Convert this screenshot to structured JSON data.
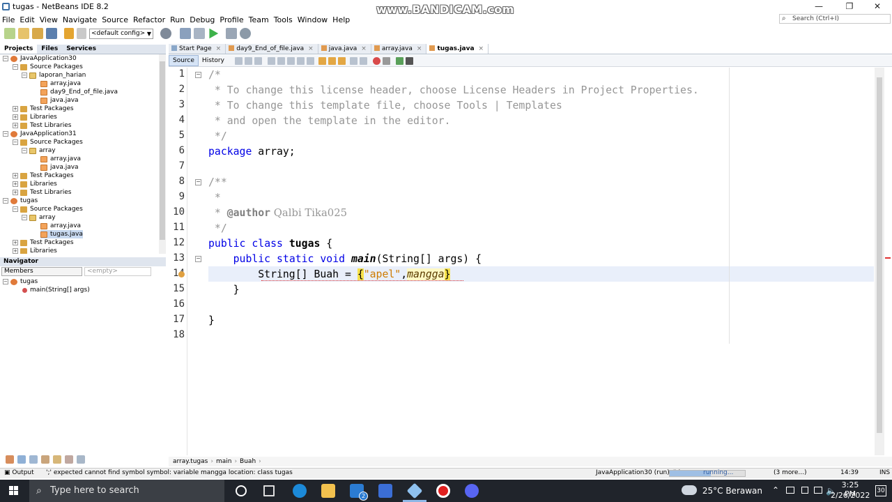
{
  "window": {
    "title": "tugas - NetBeans IDE 8.2",
    "watermark": "www.BANDICAM.com",
    "minimize": "—",
    "maximize": "❐",
    "close": "✕"
  },
  "menu": [
    "File",
    "Edit",
    "View",
    "Navigate",
    "Source",
    "Refactor",
    "Run",
    "Debug",
    "Profile",
    "Team",
    "Tools",
    "Window",
    "Help"
  ],
  "search": {
    "placeholder": "Search (Ctrl+I)"
  },
  "toolbar": {
    "config": "<default config>"
  },
  "projects_panel": {
    "tabs": [
      "Projects",
      "Files",
      "Services"
    ],
    "tree": [
      {
        "label": "JavaApplication30",
        "icon": "project",
        "level": 0,
        "expander": "−"
      },
      {
        "label": "Source Packages",
        "icon": "pkgs",
        "level": 1,
        "expander": "−"
      },
      {
        "label": "laporan_harian",
        "icon": "pkg",
        "level": 2,
        "expander": "−"
      },
      {
        "label": "array.java",
        "icon": "java",
        "level": 3,
        "expander": ""
      },
      {
        "label": "day9_End_of_file.java",
        "icon": "java",
        "level": 3,
        "expander": ""
      },
      {
        "label": "java.java",
        "icon": "java",
        "level": 3,
        "expander": ""
      },
      {
        "label": "Test Packages",
        "icon": "pkgs",
        "level": 1,
        "expander": "+"
      },
      {
        "label": "Libraries",
        "icon": "lib",
        "level": 1,
        "expander": "+"
      },
      {
        "label": "Test Libraries",
        "icon": "lib",
        "level": 1,
        "expander": "+"
      },
      {
        "label": "JavaApplication31",
        "icon": "project",
        "level": 0,
        "expander": "−"
      },
      {
        "label": "Source Packages",
        "icon": "pkgs",
        "level": 1,
        "expander": "−"
      },
      {
        "label": "array",
        "icon": "pkg",
        "level": 2,
        "expander": "−"
      },
      {
        "label": "array.java",
        "icon": "java",
        "level": 3,
        "expander": ""
      },
      {
        "label": "java.java",
        "icon": "java",
        "level": 3,
        "expander": ""
      },
      {
        "label": "Test Packages",
        "icon": "pkgs",
        "level": 1,
        "expander": "+"
      },
      {
        "label": "Libraries",
        "icon": "lib",
        "level": 1,
        "expander": "+"
      },
      {
        "label": "Test Libraries",
        "icon": "lib",
        "level": 1,
        "expander": "+"
      },
      {
        "label": "tugas",
        "icon": "project",
        "level": 0,
        "expander": "−"
      },
      {
        "label": "Source Packages",
        "icon": "pkgs",
        "level": 1,
        "expander": "−"
      },
      {
        "label": "array",
        "icon": "pkg",
        "level": 2,
        "expander": "−"
      },
      {
        "label": "array.java",
        "icon": "java",
        "level": 3,
        "expander": ""
      },
      {
        "label": "tugas.java",
        "icon": "java",
        "level": 3,
        "expander": "",
        "selected": true
      },
      {
        "label": "Test Packages",
        "icon": "pkgs",
        "level": 1,
        "expander": "+"
      },
      {
        "label": "Libraries",
        "icon": "lib",
        "level": 1,
        "expander": "+"
      }
    ]
  },
  "navigator": {
    "title": "Navigator",
    "filter": "Members",
    "empty": "<empty>",
    "root": "tugas",
    "method": "main(String[] args)"
  },
  "editor": {
    "tabs": [
      {
        "label": "Start Page",
        "active": false
      },
      {
        "label": "day9_End_of_file.java",
        "active": false
      },
      {
        "label": "java.java",
        "active": false
      },
      {
        "label": "array.java",
        "active": false
      },
      {
        "label": "tugas.java",
        "active": true
      }
    ],
    "modes": [
      "Source",
      "History"
    ],
    "line_numbers": [
      "1",
      "2",
      "3",
      "4",
      "5",
      "6",
      "7",
      "8",
      "9",
      "10",
      "11",
      "12",
      "13",
      "14",
      "15",
      "16",
      "17",
      "18"
    ],
    "lines": [
      "/*",
      " * To change this license header, choose License Headers in Project Properties.",
      " * To change this template file, choose Tools | Templates",
      " * and open the template in the editor.",
      " */",
      "package array;",
      "",
      "/**",
      " *",
      " * @author Qalbi Tika025",
      " */",
      "public class tugas {",
      "    public static void main(String[] args) {",
      "        String[] Buah = {\"apel\",mangga}",
      "    }",
      "",
      "}",
      ""
    ]
  },
  "breadcrumb": [
    "array.tugas",
    "main",
    "Buah"
  ],
  "statusbar": {
    "output_label": "Output",
    "error": "';' expected  cannot find symbol  symbol:  variable mangga  location: class tugas",
    "run": "JavaApplication30 (run) #4",
    "running": "running...",
    "more": "(3 more...)",
    "position": "14:39",
    "mode": "INS",
    "progress": 0.55
  },
  "taskbar": {
    "search_placeholder": "Type here to search",
    "weather": "25°C  Berawan",
    "time": "3:25 PM",
    "date": "2/26/2022",
    "notifications": "30",
    "mail_badge": "2"
  }
}
